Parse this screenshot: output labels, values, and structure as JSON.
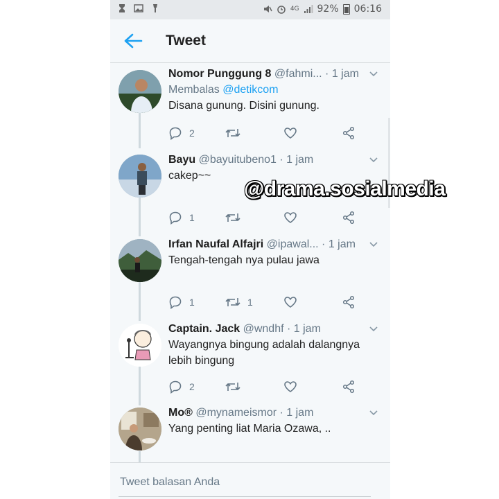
{
  "status_bar": {
    "battery": "92%",
    "time": "06:16",
    "network": "4G"
  },
  "header": {
    "title": "Tweet"
  },
  "tweets": [
    {
      "name": "Nomor Punggung 8",
      "handle": "@fahmi...",
      "time": "1 jam",
      "reply_prefix": "Membalas",
      "reply_mention": "@detikcom",
      "text": "Disana gunung. Disini gunung.",
      "replies": "2",
      "retweets": "",
      "avatar_colors": [
        "#6f8f9a",
        "#2e4a2a"
      ]
    },
    {
      "name": "Bayu",
      "handle": "@bayuitubeno1",
      "time": "1 jam",
      "text": "cakep~~",
      "replies": "1",
      "retweets": "",
      "avatar_colors": [
        "#7fa6c9",
        "#3a4c5c"
      ]
    },
    {
      "name": "Irfan Naufal Alfajri",
      "handle": "@ipawal...",
      "time": "1 jam",
      "text": "Tengah-tengah nya pulau jawa",
      "replies": "1",
      "retweets": "1",
      "avatar_colors": [
        "#4d6b4a",
        "#1e2b1d"
      ]
    },
    {
      "name": "Captain. Jack",
      "handle": "@wndhf",
      "time": "1 jam",
      "text": "Wayangnya bingung adalah dalangnya lebih bingung",
      "replies": "2",
      "retweets": "",
      "avatar_colors": [
        "#f3f3f3",
        "#d88aa6"
      ]
    },
    {
      "name": "Mo®",
      "handle": "@mynameismor",
      "time": "1 jam",
      "text": "Yang penting liat Maria Ozawa, ..",
      "replies": "",
      "retweets": "",
      "avatar_colors": [
        "#b4a58c",
        "#4b3c2e"
      ]
    }
  ],
  "watermark": "@drama.sosialmedia",
  "composer": {
    "placeholder": "Tweet balasan Anda"
  }
}
